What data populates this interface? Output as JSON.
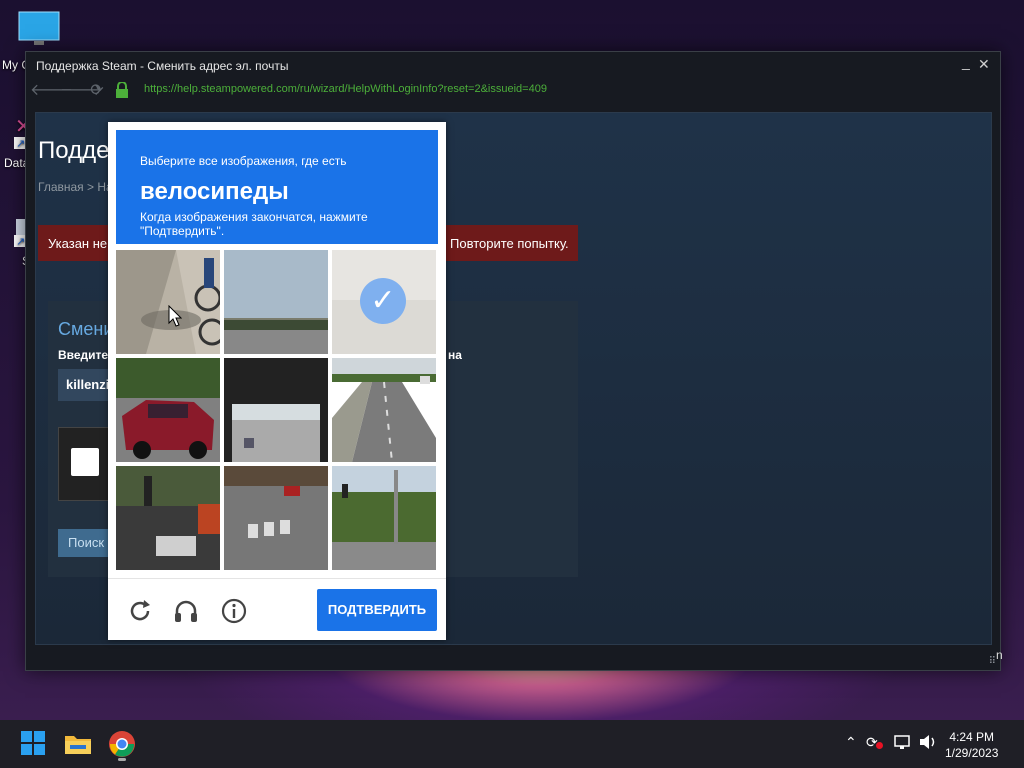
{
  "desktop": {
    "icons": [
      {
        "label": "My C",
        "icon": "computer-icon"
      },
      {
        "label": "Data",
        "icon": "shortcut-icon"
      },
      {
        "label": "S",
        "icon": "shortcut-icon"
      }
    ]
  },
  "window": {
    "title": "Поддержка Steam - Сменить адрес эл. почты",
    "url": "https://help.steampowered.com/ru/wizard/HelpWithLoginInfo?reset=2&issueid=409",
    "minimize": "_",
    "close": "✕"
  },
  "page": {
    "title": "Подде",
    "breadcrumb": "Главная > На",
    "error_left": "Указан нев",
    "error_right": "Повторите попытку.",
    "panel_title": "Смени",
    "panel_label": "Введите",
    "panel_label_end": "на",
    "input_value": "killenzi",
    "search_button": "Поиск",
    "side_letter": "n"
  },
  "captcha": {
    "prompt": "Выберите все изображения, где есть",
    "target": "велосипеды",
    "hint": "Когда изображения закончатся, нажмите \"Подтвердить\".",
    "verify_button": "ПОДТВЕРДИТЬ",
    "tiles": [
      {
        "name": "bicycle-rider",
        "selected": false
      },
      {
        "name": "highway-overpass",
        "selected": false
      },
      {
        "name": "faded-loading",
        "selected": true
      },
      {
        "name": "red-car",
        "selected": false
      },
      {
        "name": "tunnel-road",
        "selected": false
      },
      {
        "name": "highway-lanes",
        "selected": false
      },
      {
        "name": "traffic-lights-store",
        "selected": false
      },
      {
        "name": "crosswalk",
        "selected": false
      },
      {
        "name": "traffic-light-trees",
        "selected": false
      }
    ],
    "colors": {
      "accent": "#1a73e8"
    }
  },
  "taskbar": {
    "time": "4:24 PM",
    "date": "1/29/2023",
    "icons": [
      "windows-start-icon",
      "file-explorer-icon",
      "chrome-icon"
    ]
  }
}
